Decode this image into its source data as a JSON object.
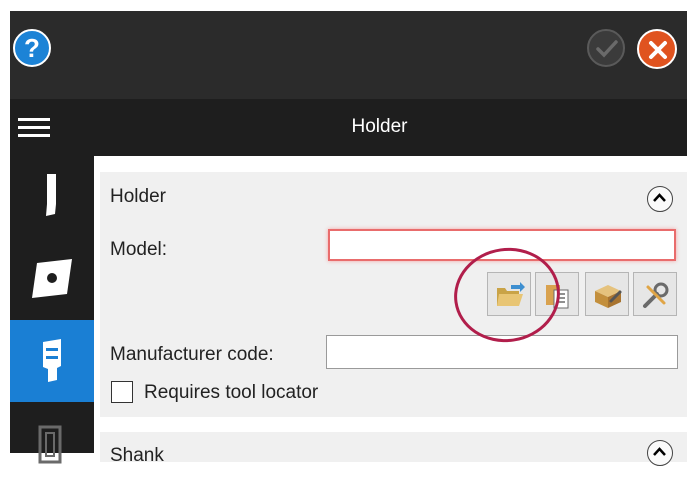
{
  "header": {
    "title": "Holder"
  },
  "icons": {
    "help": "help-icon",
    "ok": "check-icon",
    "cancel": "close-icon",
    "menu": "hamburger-menu-icon",
    "sidebar": [
      "tool-icon",
      "insert-icon",
      "holder-icon",
      "shank-icon"
    ],
    "model_tools": [
      "open-folder-icon",
      "clipboard-icon",
      "box-settings-icon",
      "wrench-settings-icon"
    ]
  },
  "holder_section": {
    "title": "Holder",
    "model_label": "Model:",
    "model_value": "",
    "manufacturer_label": "Manufacturer code:",
    "manufacturer_value": "",
    "requires_locator_label": "Requires tool locator",
    "requires_locator_checked": false
  },
  "next_section": {
    "title": "Shank"
  },
  "colors": {
    "titlebar": "#2b2b2b",
    "sidebar": "#1e1e1e",
    "active_tab": "#1a7fd4",
    "panel": "#f0f0f0",
    "cancel": "#e0531f",
    "help": "#1c83d6",
    "annotation": "#b11e4b",
    "invalid_input": "#e96c6c"
  }
}
